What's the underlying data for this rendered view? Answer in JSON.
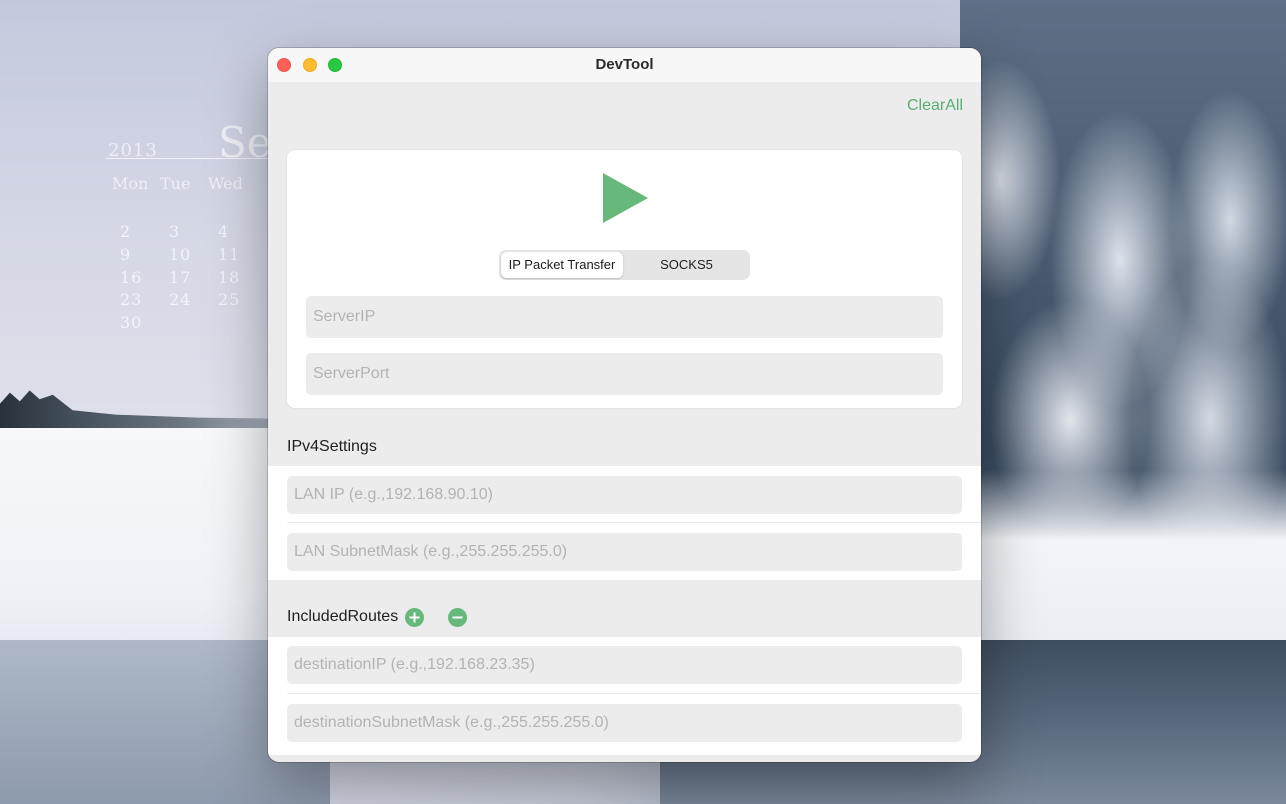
{
  "desktop": {
    "calendar": {
      "year": "2013",
      "month": "Se",
      "weekdays": [
        "Mon",
        "Tue",
        "Wed"
      ],
      "rows": [
        [
          "2",
          "3",
          "4"
        ],
        [
          "9",
          "10",
          "11"
        ],
        [
          "16",
          "17",
          "18"
        ],
        [
          "23",
          "24",
          "25"
        ],
        [
          "30",
          "",
          ""
        ]
      ]
    }
  },
  "window": {
    "title": "DevTool",
    "clear_all_label": "ClearAll",
    "play_icon": "play-icon",
    "accent_color": "#5aad72",
    "mode_tabs": [
      {
        "label": "IP Packet Transfer",
        "selected": true
      },
      {
        "label": "SOCKS5",
        "selected": false
      }
    ],
    "server_ip": {
      "value": "",
      "placeholder": "ServerIP"
    },
    "server_port": {
      "value": "",
      "placeholder": "ServerPort"
    },
    "ipv4_settings": {
      "label": "IPv4Settings",
      "lan_ip": {
        "value": "",
        "placeholder": "LAN IP (e.g.,192.168.90.10)"
      },
      "lan_subnet_mask": {
        "value": "",
        "placeholder": "LAN SubnetMask (e.g.,255.255.255.0)"
      }
    },
    "included_routes": {
      "label": "IncludedRoutes",
      "add_icon": "plus-circle-icon",
      "remove_icon": "minus-circle-icon",
      "destination_ip": {
        "value": "",
        "placeholder": "destinationIP (e.g.,192.168.23.35)"
      },
      "destination_subnet_mask": {
        "value": "",
        "placeholder": "destinationSubnetMask (e.g.,255.255.255.0)"
      }
    }
  }
}
